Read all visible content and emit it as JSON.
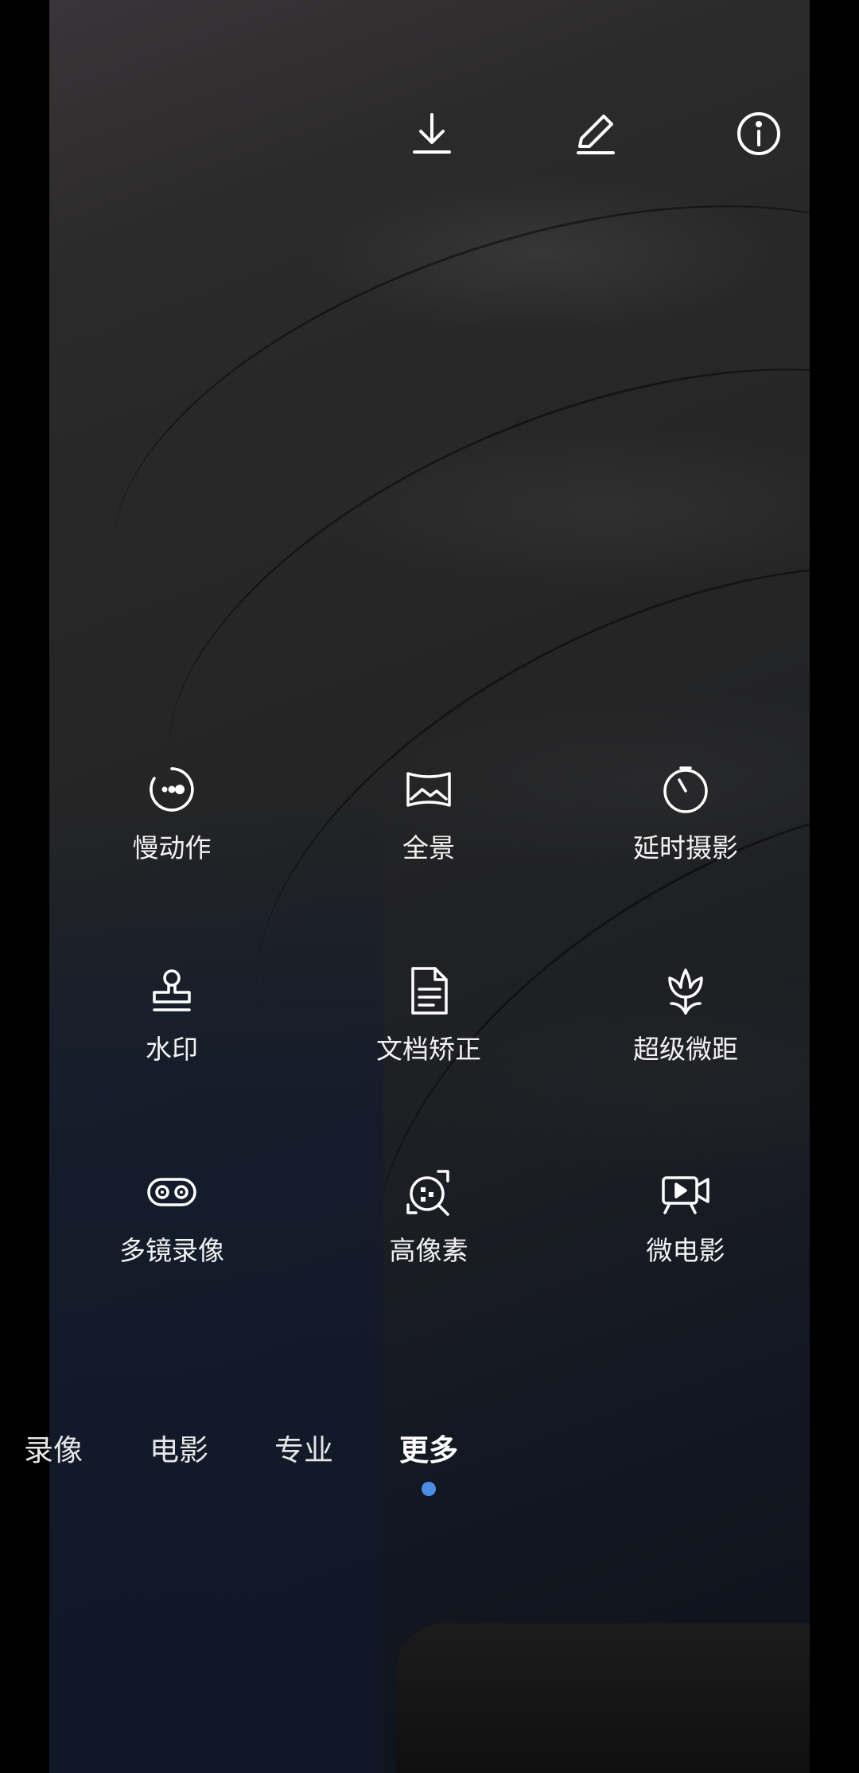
{
  "top_bar": {
    "icons": [
      "download-icon",
      "edit-pencil-icon",
      "info-icon"
    ]
  },
  "mode_grid": {
    "items": [
      {
        "label": "慢动作",
        "icon": "slow-motion-icon"
      },
      {
        "label": "全景",
        "icon": "panorama-icon"
      },
      {
        "label": "延时摄影",
        "icon": "time-lapse-icon"
      },
      {
        "label": "水印",
        "icon": "watermark-stamp-icon"
      },
      {
        "label": "文档矫正",
        "icon": "document-icon"
      },
      {
        "label": "超级微距",
        "icon": "macro-flower-icon"
      },
      {
        "label": "多镜录像",
        "icon": "dual-view-icon"
      },
      {
        "label": "高像素",
        "icon": "high-resolution-icon"
      },
      {
        "label": "微电影",
        "icon": "micro-movie-icon"
      }
    ]
  },
  "mode_tabs": {
    "items": [
      "录像",
      "电影",
      "专业",
      "更多"
    ],
    "active_index": 3,
    "indicator_color": "#4a8ee6"
  }
}
